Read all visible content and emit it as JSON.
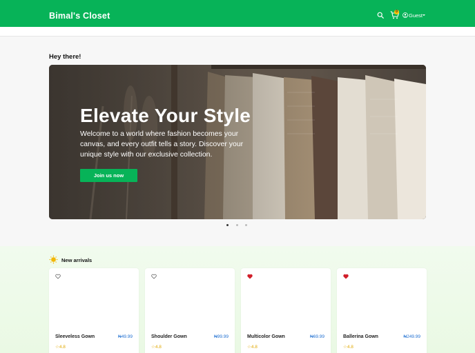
{
  "header": {
    "brand": "Bimal's Closet",
    "cart_count": "0",
    "user_label": "Guest"
  },
  "greeting": "Hey there!",
  "hero": {
    "title": "Elevate Your Style",
    "description": "Welcome to a world where fashion becomes your canvas, and every outfit tells a story. Discover your unique style with our exclusive collection.",
    "button_label": "Join us now",
    "slides": 3,
    "active_slide": 1
  },
  "arrivals": {
    "title": "New arrivals",
    "products": [
      {
        "name": "Sleeveless Gown",
        "price": "₦49.99",
        "rating": "4.8",
        "favorited": false
      },
      {
        "name": "Shoulder Gown",
        "price": "₦99.99",
        "rating": "4.8",
        "favorited": false
      },
      {
        "name": "Multicolor Gown",
        "price": "₦69.99",
        "rating": "4.8",
        "favorited": true
      },
      {
        "name": "Ballerina Gown",
        "price": "₦249.99",
        "rating": "4.8",
        "favorited": true
      }
    ]
  },
  "colors": {
    "brand_green": "#07b358",
    "badge_yellow": "#ffc107",
    "heart_red": "#d11f2a",
    "price_blue": "#1f6fd1"
  },
  "icons": [
    "search-icon",
    "cart-icon",
    "user-icon",
    "chevron-down-icon",
    "sun-icon",
    "heart-icon",
    "star-icon"
  ]
}
